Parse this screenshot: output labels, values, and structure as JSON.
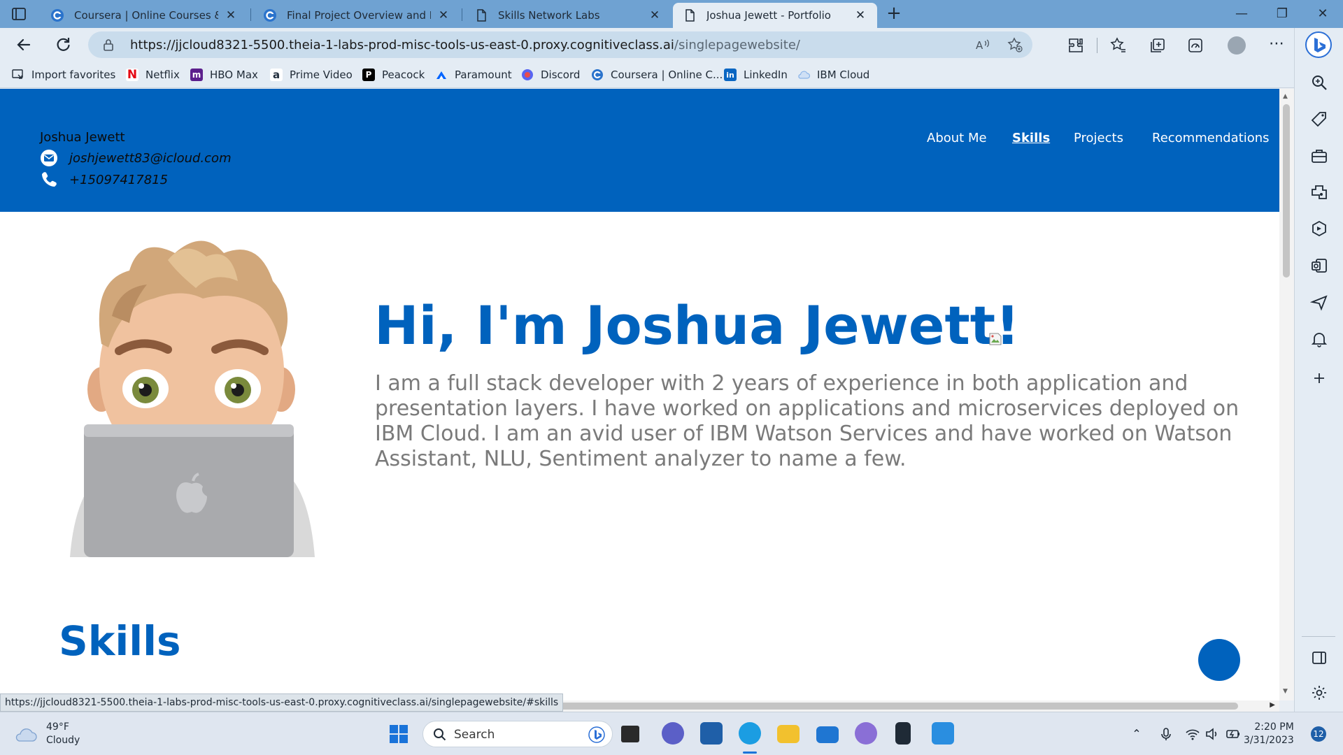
{
  "browser": {
    "tabs": [
      {
        "label": "Coursera | Online Courses & Cre",
        "icon": "coursera-icon"
      },
      {
        "label": "Final Project Overview and Revie",
        "icon": "coursera-icon"
      },
      {
        "label": "Skills Network Labs",
        "icon": "page-icon"
      },
      {
        "label": "Joshua Jewett - Portfolio",
        "icon": "page-icon"
      }
    ],
    "active_tab": 3,
    "url_main": "https://jjcloud8321-5500.theia-1-labs-prod-misc-tools-us-east-0.proxy.cognitiveclass.ai",
    "url_path": "/singlepagewebsite/",
    "status_url": "https://jjcloud8321-5500.theia-1-labs-prod-misc-tools-us-east-0.proxy.cognitiveclass.ai/singlepagewebsite/#skills",
    "favorites": [
      {
        "label": "Import favorites",
        "icon": "import-icon",
        "color": "#1f2a36"
      },
      {
        "label": "Netflix",
        "icon": "netflix-icon",
        "color": "#e50914"
      },
      {
        "label": "HBO Max",
        "icon": "hbomax-icon",
        "color": "#5b1f8c"
      },
      {
        "label": "Prime Video",
        "icon": "amazon-icon",
        "color": "#232f3e"
      },
      {
        "label": "Peacock",
        "icon": "peacock-icon",
        "color": "#000000"
      },
      {
        "label": "Paramount",
        "icon": "paramount-icon",
        "color": "#0064ff"
      },
      {
        "label": "Discord",
        "icon": "discord-icon",
        "color": "#5865f2"
      },
      {
        "label": "Coursera | Online C...",
        "icon": "coursera-icon",
        "color": "#0056d2"
      },
      {
        "label": "LinkedIn",
        "icon": "linkedin-icon",
        "color": "#0a66c2"
      },
      {
        "label": "IBM Cloud",
        "icon": "cloud-icon",
        "color": "#8ab4e8"
      }
    ]
  },
  "site": {
    "brand": "Joshua Jewett",
    "email": "joshjewett83@icloud.com",
    "phone": "+15097417815",
    "nav": [
      "About Me",
      "Skills",
      "Projects",
      "Recommendations"
    ],
    "active_nav": "Skills",
    "hero_title": "Hi, I'm Joshua Jewett!",
    "hero_text": "I am a full stack developer with 2 years of experience in both application and presentation layers. I have worked on applications and microservices deployed on IBM Cloud. I am an avid user of IBM Watson Services and have worked on Watson Assistant, NLU, Sentiment analyzer to name a few.",
    "section_title": "Skills",
    "accent_color": "#0062bd"
  },
  "taskbar": {
    "temperature": "49°F",
    "condition": "Cloudy",
    "search_placeholder": "Search",
    "time": "2:20 PM",
    "date": "3/31/2023",
    "notifications": "12"
  }
}
